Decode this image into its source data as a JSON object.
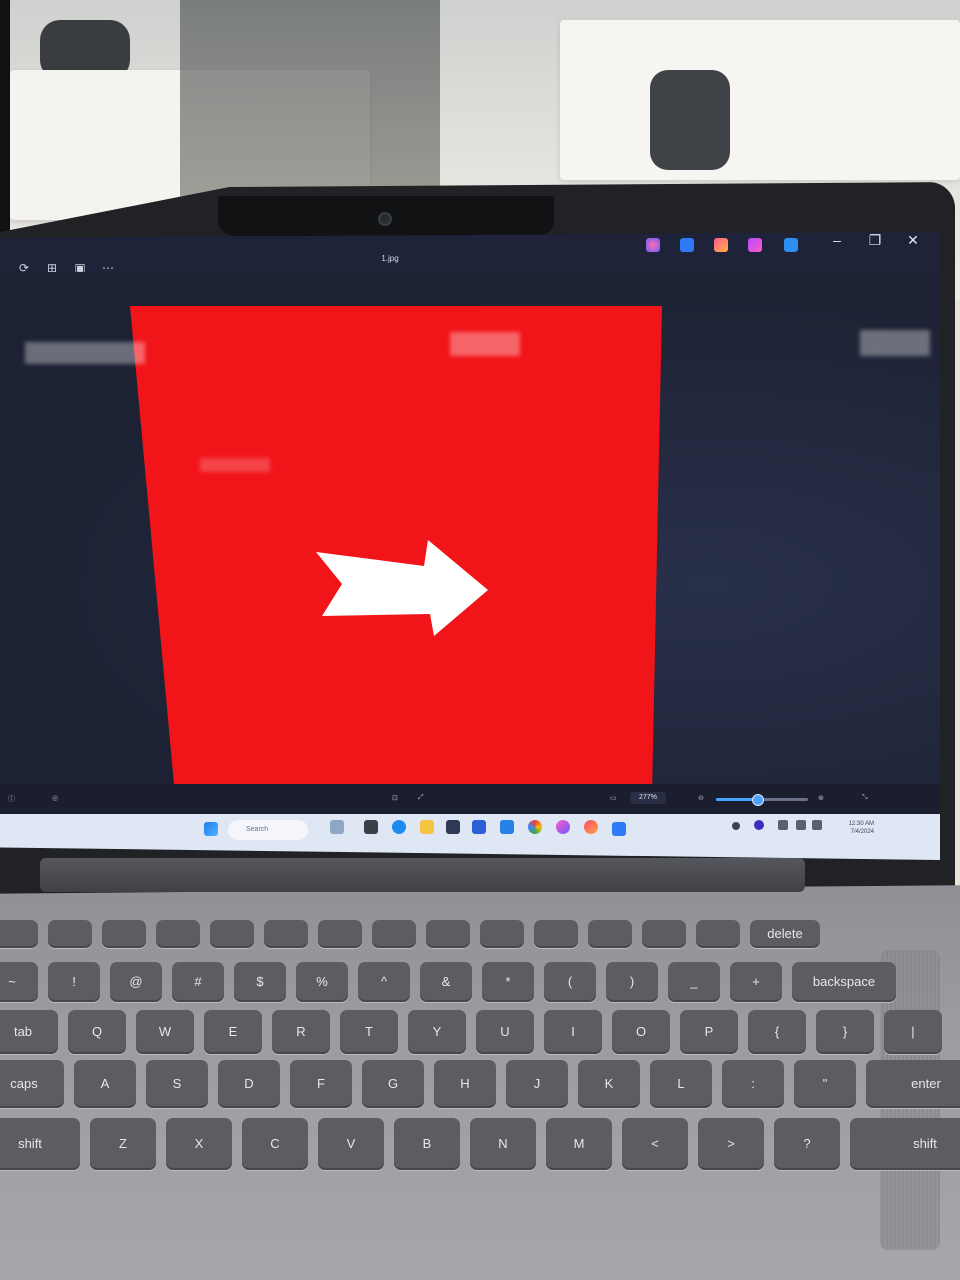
{
  "photo": {
    "environment": "office",
    "laptop_screen": {
      "window_title": "1.jpg",
      "image_content": {
        "background_color": "#f11419",
        "arrow_color": "#ffffff",
        "arrow_direction": "right"
      },
      "status_bar": {
        "zoom_value": "277%",
        "zoom_slider_level": 0.45
      },
      "taskbar": {
        "search_placeholder": "Search",
        "clock_time": "12:30 AM",
        "clock_date": "7/4/2024"
      },
      "window_controls": [
        "minimize-icon",
        "restore-icon",
        "close-icon"
      ]
    },
    "keyboard": {
      "rows": [
        [
          "",
          "",
          "",
          "",
          "",
          "",
          "",
          "",
          "",
          "",
          "",
          "",
          "",
          "",
          "delete"
        ],
        [
          "~",
          "!",
          "@",
          "#",
          "$",
          "%",
          "^",
          "&",
          "*",
          "(",
          ")",
          "_",
          "+",
          "backspace"
        ],
        [
          "tab",
          "Q",
          "W",
          "E",
          "R",
          "T",
          "Y",
          "U",
          "I",
          "O",
          "P",
          "{",
          "}",
          "|"
        ],
        [
          "caps",
          "A",
          "S",
          "D",
          "F",
          "G",
          "H",
          "J",
          "K",
          "L",
          ":",
          "\"",
          "enter"
        ],
        [
          "shift",
          "Z",
          "X",
          "C",
          "V",
          "B",
          "N",
          "M",
          "<",
          ">",
          "?",
          "shift"
        ]
      ]
    }
  }
}
